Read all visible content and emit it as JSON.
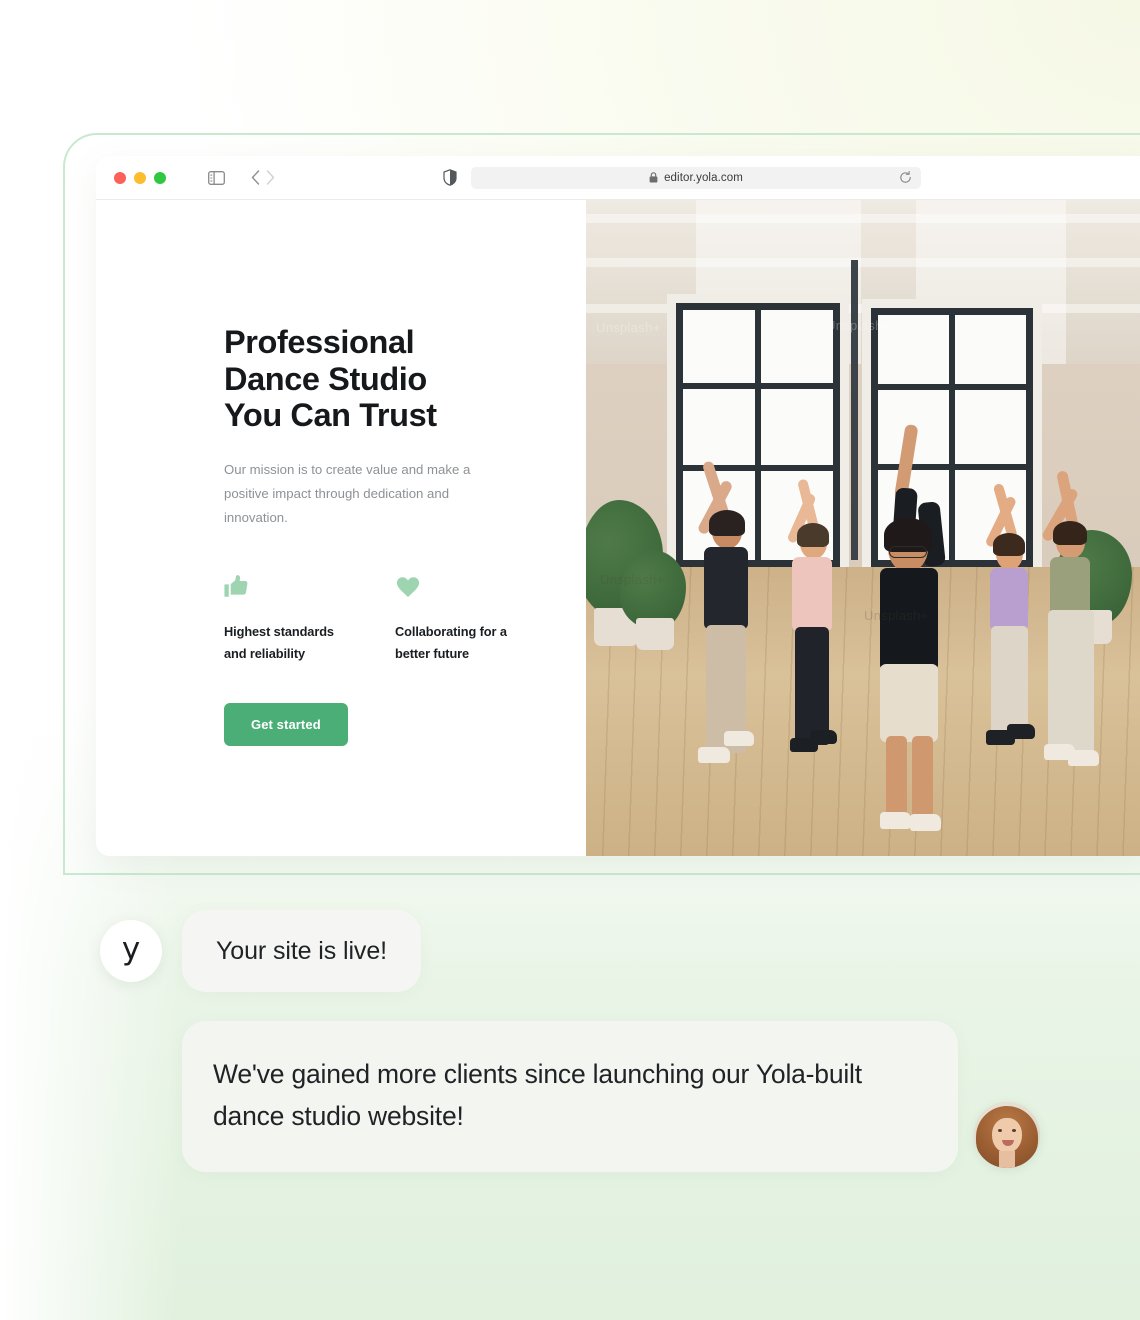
{
  "browser": {
    "url": "editor.yola.com",
    "icons": {
      "sidebar": "sidebar-toggle-icon",
      "back": "chevron-left-icon",
      "forward": "chevron-right-icon",
      "shield": "shield-icon",
      "lock": "lock-icon",
      "reload": "reload-icon"
    },
    "traffic_lights": [
      "close",
      "minimize",
      "zoom"
    ]
  },
  "hero": {
    "title_lines": [
      "Professional",
      "Dance Studio",
      "You Can Trust"
    ],
    "title": "Professional Dance Studio You Can Trust",
    "subtitle": "Our mission is to create value and make a positive impact through dedication and innovation.",
    "features": [
      {
        "icon": "thumbs-up-icon",
        "label": "Highest standards and reliability"
      },
      {
        "icon": "heart-icon",
        "label": "Collaborating for a better future"
      }
    ],
    "cta_label": "Get started",
    "photo_watermarks": [
      "Unsplash+",
      "Unsplash+",
      "Unsplash+",
      "Unsplash+"
    ]
  },
  "chat": {
    "brand_mark": "y",
    "messages": [
      {
        "from": "yola",
        "text": "Your site is live!"
      },
      {
        "from": "user",
        "text": "We've gained more clients since launching our Yola-built dance studio website!"
      }
    ]
  },
  "colors": {
    "accent_green": "#4bae77",
    "soft_green": "#9ed4af",
    "frame_green": "#c8e9cf",
    "bubble_gray": "#f5f5f3",
    "text_dark": "#1f2326",
    "text_muted": "#8d9296"
  }
}
